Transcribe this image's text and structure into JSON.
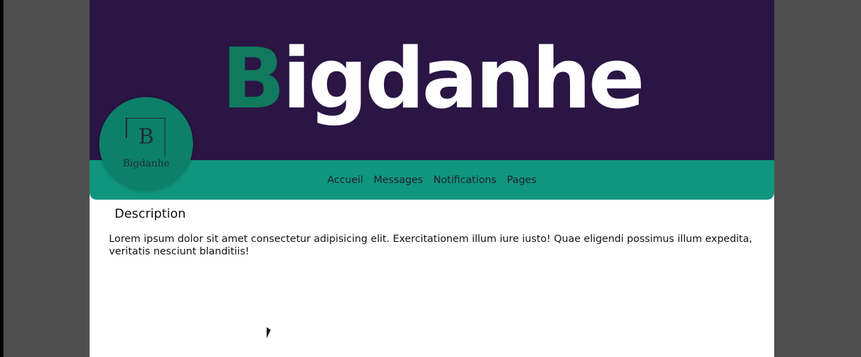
{
  "header": {
    "title_first": "B",
    "title_rest": "igdanhe"
  },
  "logo": {
    "letter": "B",
    "name": "Bigdanhe"
  },
  "nav": {
    "items": [
      {
        "label": "Accueil"
      },
      {
        "label": "Messages"
      },
      {
        "label": "Notifications"
      },
      {
        "label": "Pages"
      }
    ]
  },
  "content": {
    "heading": "Description",
    "text": "Lorem ipsum dolor sit amet consectetur adipisicing elit. Exercitationem illum iure iusto! Quae eligendi possimus illum expedita, veritatis nesciunt blanditiis!"
  },
  "colors": {
    "banner": "#2a1545",
    "accent": "#10967e",
    "title_accent": "#0f7a5e"
  }
}
